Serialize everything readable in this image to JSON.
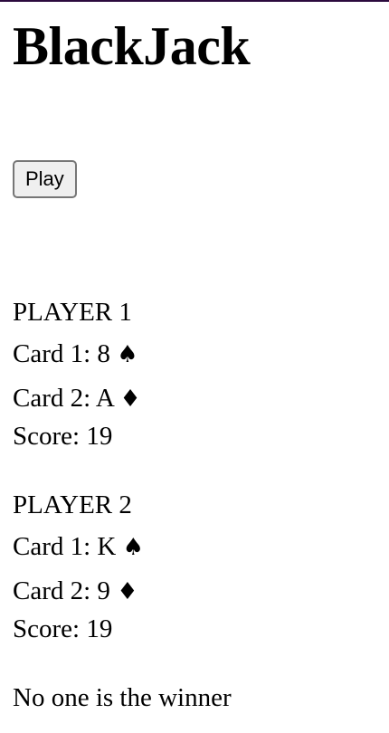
{
  "title": "BlackJack",
  "play_button": "Play",
  "players": [
    {
      "label": "PLAYER 1",
      "card1_prefix": "Card 1: 8",
      "card1_suit": "♠",
      "card2_prefix": "Card 2: A",
      "card2_suit": "♦",
      "score": "Score: 19"
    },
    {
      "label": "PLAYER 2",
      "card1_prefix": "Card 1: K",
      "card1_suit": "♠",
      "card2_prefix": "Card 2: 9",
      "card2_suit": "♦",
      "score": "Score: 19"
    }
  ],
  "result": "No one is the winner"
}
